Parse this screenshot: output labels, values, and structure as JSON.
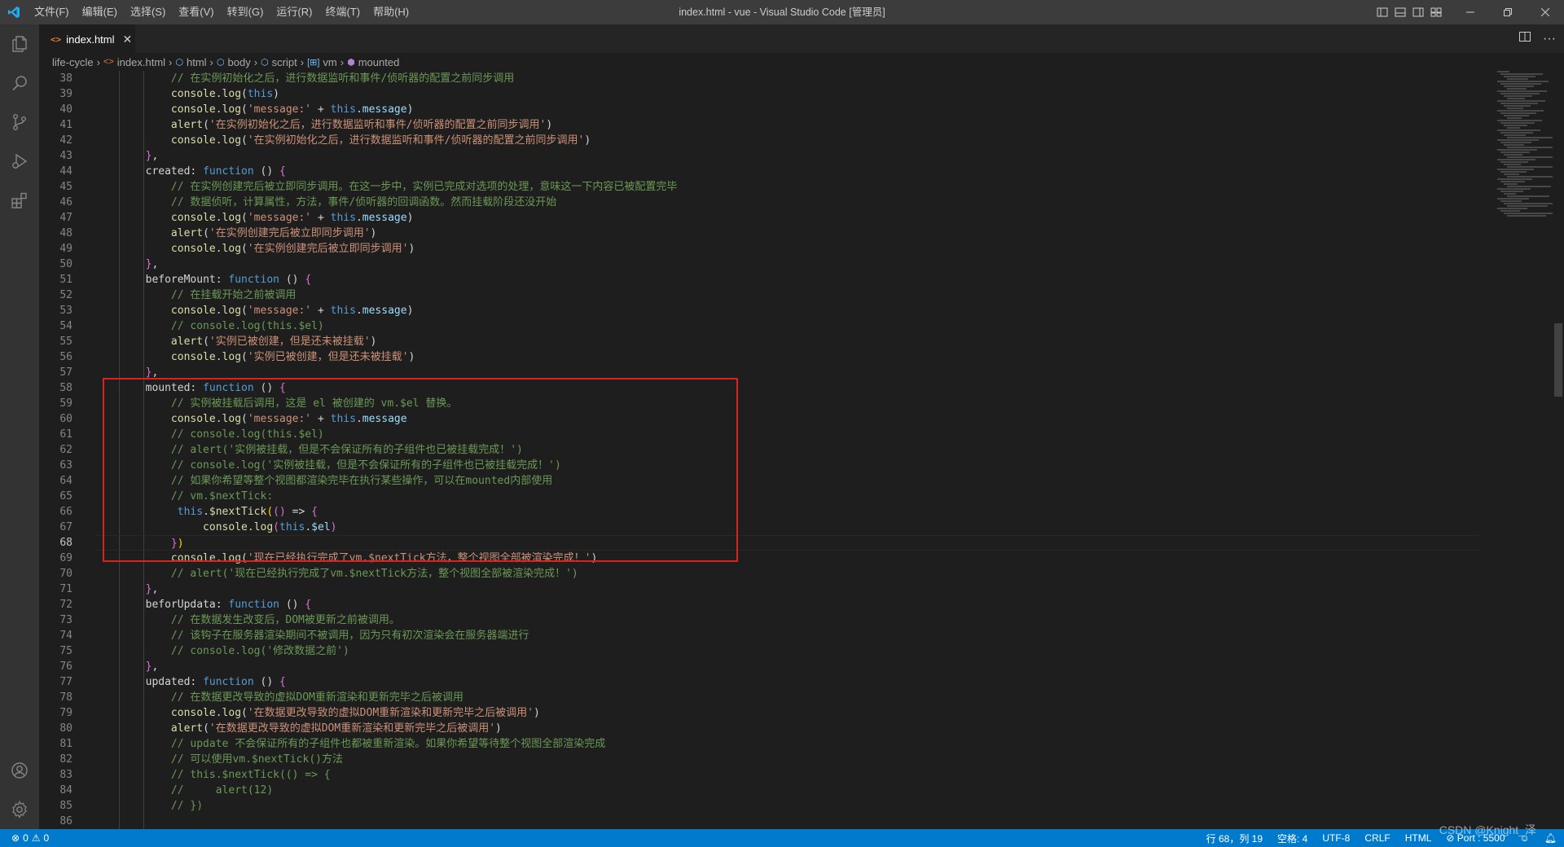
{
  "menu": [
    "文件(F)",
    "编辑(E)",
    "选择(S)",
    "查看(V)",
    "转到(G)",
    "运行(R)",
    "终端(T)",
    "帮助(H)"
  ],
  "window_title": "index.html - vue - Visual Studio Code [管理员]",
  "tab": {
    "label": "index.html",
    "icon": "html-icon"
  },
  "breadcrumb": [
    "life-cycle",
    "index.html",
    "html",
    "body",
    "script",
    "vm",
    "mounted"
  ],
  "editor": {
    "first_line": 38,
    "active_line": 68,
    "lines": [
      "38",
      "39",
      "40",
      "41",
      "42",
      "43",
      "44",
      "45",
      "46",
      "47",
      "48",
      "49",
      "50",
      "51",
      "52",
      "53",
      "54",
      "55",
      "56",
      "57",
      "58",
      "59",
      "60",
      "61",
      "62",
      "63",
      "64",
      "65",
      "66",
      "67",
      "68",
      "69",
      "70",
      "71",
      "72",
      "73",
      "74",
      "75",
      "76",
      "77",
      "78",
      "79",
      "80",
      "81",
      "82",
      "83",
      "84",
      "85",
      "86"
    ],
    "code": [
      {
        "i": 6,
        "t": [
          [
            "cm",
            "// 在实例初始化之后，进行数据监听和事件/侦听器的配置之前同步调用"
          ]
        ]
      },
      {
        "i": 6,
        "t": [
          [
            "fn",
            "console"
          ],
          [
            "",
            "."
          ],
          [
            "fn",
            "log"
          ],
          [
            "",
            "("
          ],
          [
            "kw",
            "this"
          ],
          [
            "",
            ")"
          ]
        ]
      },
      {
        "i": 6,
        "t": [
          [
            "fn",
            "console"
          ],
          [
            "",
            "."
          ],
          [
            "fn",
            "log"
          ],
          [
            "",
            "("
          ],
          [
            "st",
            "'message:'"
          ],
          [
            "",
            " + "
          ],
          [
            "kw",
            "this"
          ],
          [
            "",
            "."
          ],
          [
            "pr",
            "message"
          ],
          [
            "",
            ")"
          ]
        ]
      },
      {
        "i": 6,
        "t": [
          [
            "fn",
            "alert"
          ],
          [
            "",
            "("
          ],
          [
            "st",
            "'在实例初始化之后，进行数据监听和事件/侦听器的配置之前同步调用'"
          ],
          [
            "",
            ")"
          ]
        ]
      },
      {
        "i": 6,
        "t": [
          [
            "fn",
            "console"
          ],
          [
            "",
            "."
          ],
          [
            "fn",
            "log"
          ],
          [
            "",
            "("
          ],
          [
            "st",
            "'在实例初始化之后，进行数据监听和事件/侦听器的配置之前同步调用'"
          ],
          [
            "",
            ")"
          ]
        ]
      },
      {
        "i": 4,
        "t": [
          [
            "br2",
            "}"
          ],
          [
            "",
            ","
          ]
        ]
      },
      {
        "i": 4,
        "t": [
          [
            "",
            "created: "
          ],
          [
            "kw",
            "function"
          ],
          [
            "",
            " () "
          ],
          [
            "br2",
            "{"
          ]
        ]
      },
      {
        "i": 6,
        "t": [
          [
            "cm",
            "// 在实例创建完后被立即同步调用。在这一步中，实例已完成对选项的处理，意味这一下内容已被配置完毕"
          ]
        ]
      },
      {
        "i": 6,
        "t": [
          [
            "cm",
            "// 数据侦听，计算属性，方法，事件/侦听器的回调函数。然而挂载阶段还没开始"
          ]
        ]
      },
      {
        "i": 6,
        "t": [
          [
            "fn",
            "console"
          ],
          [
            "",
            "."
          ],
          [
            "fn",
            "log"
          ],
          [
            "",
            "("
          ],
          [
            "st",
            "'message:'"
          ],
          [
            "",
            " + "
          ],
          [
            "kw",
            "this"
          ],
          [
            "",
            "."
          ],
          [
            "pr",
            "message"
          ],
          [
            "",
            ")"
          ]
        ]
      },
      {
        "i": 6,
        "t": [
          [
            "fn",
            "alert"
          ],
          [
            "",
            "("
          ],
          [
            "st",
            "'在实例创建完后被立即同步调用'"
          ],
          [
            "",
            ")"
          ]
        ]
      },
      {
        "i": 6,
        "t": [
          [
            "fn",
            "console"
          ],
          [
            "",
            "."
          ],
          [
            "fn",
            "log"
          ],
          [
            "",
            "("
          ],
          [
            "st",
            "'在实例创建完后被立即同步调用'"
          ],
          [
            "",
            ")"
          ]
        ]
      },
      {
        "i": 4,
        "t": [
          [
            "br2",
            "}"
          ],
          [
            "",
            ","
          ]
        ]
      },
      {
        "i": 4,
        "t": [
          [
            "",
            "beforeMount: "
          ],
          [
            "kw",
            "function"
          ],
          [
            "",
            " () "
          ],
          [
            "br2",
            "{"
          ]
        ]
      },
      {
        "i": 6,
        "t": [
          [
            "cm",
            "// 在挂载开始之前被调用"
          ]
        ]
      },
      {
        "i": 6,
        "t": [
          [
            "fn",
            "console"
          ],
          [
            "",
            "."
          ],
          [
            "fn",
            "log"
          ],
          [
            "",
            "("
          ],
          [
            "st",
            "'message:'"
          ],
          [
            "",
            " + "
          ],
          [
            "kw",
            "this"
          ],
          [
            "",
            "."
          ],
          [
            "pr",
            "message"
          ],
          [
            "",
            ")"
          ]
        ]
      },
      {
        "i": 6,
        "t": [
          [
            "cm",
            "// console.log(this.$el)"
          ]
        ]
      },
      {
        "i": 6,
        "t": [
          [
            "fn",
            "alert"
          ],
          [
            "",
            "("
          ],
          [
            "st",
            "'实例已被创建，但是还未被挂载'"
          ],
          [
            "",
            ")"
          ]
        ]
      },
      {
        "i": 6,
        "t": [
          [
            "fn",
            "console"
          ],
          [
            "",
            "."
          ],
          [
            "fn",
            "log"
          ],
          [
            "",
            "("
          ],
          [
            "st",
            "'实例已被创建，但是还未被挂载'"
          ],
          [
            "",
            ")"
          ]
        ]
      },
      {
        "i": 4,
        "t": [
          [
            "br2",
            "}"
          ],
          [
            "",
            ","
          ]
        ]
      },
      {
        "i": 4,
        "t": [
          [
            "",
            "mounted: "
          ],
          [
            "kw",
            "function"
          ],
          [
            "",
            " () "
          ],
          [
            "br2",
            "{"
          ]
        ]
      },
      {
        "i": 6,
        "t": [
          [
            "cm",
            "// 实例被挂载后调用，这是 el 被创建的 vm.$el 替换。"
          ]
        ]
      },
      {
        "i": 6,
        "t": [
          [
            "fn",
            "console"
          ],
          [
            "",
            "."
          ],
          [
            "fn",
            "log"
          ],
          [
            "",
            "("
          ],
          [
            "st",
            "'message:'"
          ],
          [
            "",
            " + "
          ],
          [
            "kw",
            "this"
          ],
          [
            "",
            "."
          ],
          [
            "pr",
            "message"
          ]
        ]
      },
      {
        "i": 6,
        "t": [
          [
            "cm",
            "// console.log(this.$el)"
          ]
        ]
      },
      {
        "i": 6,
        "t": [
          [
            "cm",
            "// alert('实例被挂载，但是不会保证所有的子组件也已被挂载完成！')"
          ]
        ]
      },
      {
        "i": 6,
        "t": [
          [
            "cm",
            "// console.log('实例被挂载，但是不会保证所有的子组件也已被挂载完成！')"
          ]
        ]
      },
      {
        "i": 6,
        "t": [
          [
            "cm",
            "// 如果你希望等整个视图都渲染完毕在执行某些操作，可以在mounted内部使用"
          ]
        ]
      },
      {
        "i": 6,
        "t": [
          [
            "cm",
            "// vm.$nextTick:"
          ]
        ]
      },
      {
        "i": 6,
        "t": [
          [
            "kw",
            " this"
          ],
          [
            "",
            "."
          ],
          [
            "fn",
            "$nextTick"
          ],
          [
            "br",
            "("
          ],
          [
            "br2",
            "()"
          ],
          [
            "",
            " => "
          ],
          [
            "br2",
            "{"
          ]
        ]
      },
      {
        "i": 8,
        "t": [
          [
            "fn",
            " console"
          ],
          [
            "",
            "."
          ],
          [
            "fn",
            "log"
          ],
          [
            "br2",
            "("
          ],
          [
            "kw",
            "this"
          ],
          [
            "",
            "."
          ],
          [
            "pr",
            "$el"
          ],
          [
            "br2",
            ")"
          ]
        ]
      },
      {
        "i": 6,
        "t": [
          [
            "br2",
            "}"
          ],
          [
            "br",
            ")"
          ]
        ]
      },
      {
        "i": 6,
        "t": [
          [
            "fn",
            "console"
          ],
          [
            "",
            "."
          ],
          [
            "fn",
            "log"
          ],
          [
            "",
            "("
          ],
          [
            "st",
            "'现在已经执行完成了vm.$nextTick方法，整个视图全部被渲染完成！'"
          ],
          [
            "",
            ")"
          ]
        ]
      },
      {
        "i": 6,
        "t": [
          [
            "cm",
            "// alert('现在已经执行完成了vm.$nextTick方法，整个视图全部被渲染完成！')"
          ]
        ]
      },
      {
        "i": 4,
        "t": [
          [
            "br2",
            "}"
          ],
          [
            "",
            ","
          ]
        ]
      },
      {
        "i": 4,
        "t": [
          [
            "",
            "beforUpdata: "
          ],
          [
            "kw",
            "function"
          ],
          [
            "",
            " () "
          ],
          [
            "br2",
            "{"
          ]
        ]
      },
      {
        "i": 6,
        "t": [
          [
            "cm",
            "// 在数据发生改变后，DOM被更新之前被调用。"
          ]
        ]
      },
      {
        "i": 6,
        "t": [
          [
            "cm",
            "// 该钩子在服务器渲染期间不被调用，因为只有初次渲染会在服务器端进行"
          ]
        ]
      },
      {
        "i": 6,
        "t": [
          [
            "cm",
            "// console.log('修改数据之前')"
          ]
        ]
      },
      {
        "i": 4,
        "t": [
          [
            "br2",
            "}"
          ],
          [
            "",
            ","
          ]
        ]
      },
      {
        "i": 4,
        "t": [
          [
            "",
            "updated: "
          ],
          [
            "kw",
            "function"
          ],
          [
            "",
            " () "
          ],
          [
            "br2",
            "{"
          ]
        ]
      },
      {
        "i": 6,
        "t": [
          [
            "cm",
            "// 在数据更改导致的虚拟DOM重新渲染和更新完毕之后被调用"
          ]
        ]
      },
      {
        "i": 6,
        "t": [
          [
            "fn",
            "console"
          ],
          [
            "",
            "."
          ],
          [
            "fn",
            "log"
          ],
          [
            "",
            "("
          ],
          [
            "st",
            "'在数据更改导致的虚拟DOM重新渲染和更新完毕之后被调用'"
          ],
          [
            "",
            ")"
          ]
        ]
      },
      {
        "i": 6,
        "t": [
          [
            "fn",
            "alert"
          ],
          [
            "",
            "("
          ],
          [
            "st",
            "'在数据更改导致的虚拟DOM重新渲染和更新完毕之后被调用'"
          ],
          [
            "",
            ")"
          ]
        ]
      },
      {
        "i": 6,
        "t": [
          [
            "cm",
            "// update 不会保证所有的子组件也都被重新渲染。如果你希望等待整个视图全部渲染完成"
          ]
        ]
      },
      {
        "i": 6,
        "t": [
          [
            "cm",
            "// 可以使用vm.$nextTick()方法"
          ]
        ]
      },
      {
        "i": 6,
        "t": [
          [
            "cm",
            "// this.$nextTick(() => {"
          ]
        ]
      },
      {
        "i": 6,
        "t": [
          [
            "cm",
            "//     alert(12)"
          ]
        ]
      },
      {
        "i": 6,
        "t": [
          [
            "cm",
            "// })"
          ]
        ]
      },
      {
        "i": 0,
        "t": [
          [
            "",
            ""
          ]
        ]
      }
    ]
  },
  "status": {
    "errors": "0",
    "warnings": "0",
    "position": "行 68，列 19",
    "spaces": "空格: 4",
    "encoding": "UTF-8",
    "eol": "CRLF",
    "language": "HTML",
    "port": "Port : 5500"
  },
  "watermark": "CSDN @Knight_泽",
  "colors": {
    "accent": "#007acc",
    "highlight_box": "#e0201c"
  }
}
